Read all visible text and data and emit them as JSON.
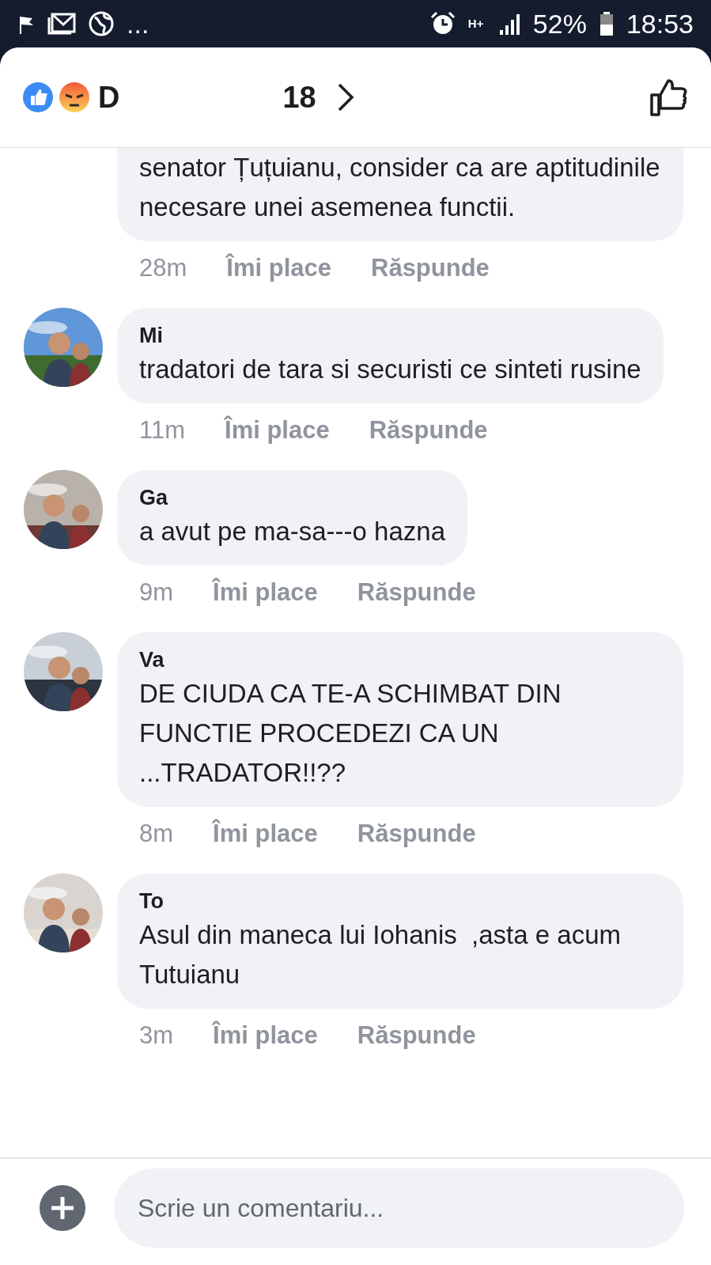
{
  "status_bar": {
    "more": "...",
    "network": "H+",
    "battery": "52%",
    "time": "18:53"
  },
  "header": {
    "reactor_name": "D",
    "reactor_count": "18"
  },
  "comments": [
    {
      "text": "senator Țuțuianu, consider ca are aptitudinile necesare unei asemenea functii.",
      "time": "28m",
      "like": "Îmi place",
      "reply": "Răspunde"
    },
    {
      "author": "Mi",
      "text": "tradatori de tara si securisti ce sinteti rusine",
      "time": "11m",
      "like": "Îmi place",
      "reply": "Răspunde"
    },
    {
      "author": "Ga",
      "text": "a avut pe ma-sa---o hazna",
      "time": "9m",
      "like": "Îmi place",
      "reply": "Răspunde"
    },
    {
      "author": "Va",
      "text": "DE CIUDA CA TE-A SCHIMBAT DIN FUNCTIE PROCEDEZI CA UN ...TRADATOR!!??",
      "time": "8m",
      "like": "Îmi place",
      "reply": "Răspunde"
    },
    {
      "author": "To",
      "text": "Asul din maneca lui Iohanis  ,asta e acum Tutuianu",
      "time": "3m",
      "like": "Îmi place",
      "reply": "Răspunde"
    }
  ],
  "composer": {
    "placeholder": "Scrie un comentariu..."
  }
}
